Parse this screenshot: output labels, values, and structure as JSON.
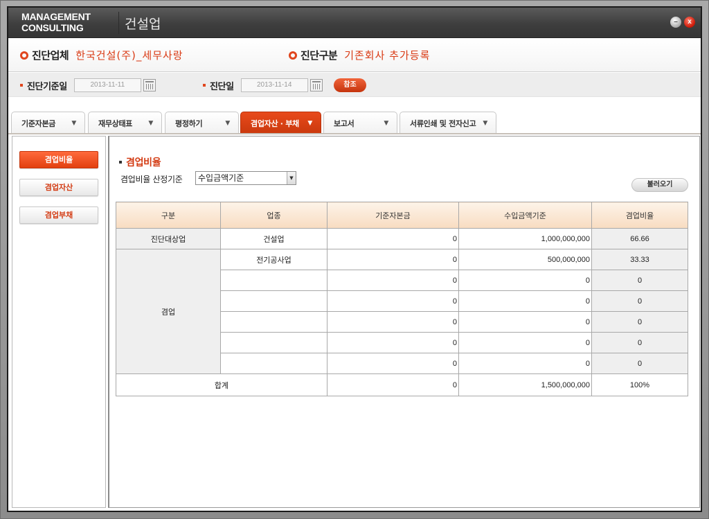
{
  "brand": {
    "line1": "MANAGEMENT",
    "line2": "CONSULTING"
  },
  "app_title": "건설업",
  "window_controls": {
    "minimize": "–",
    "close": "x"
  },
  "info": {
    "company_label": "진단업체",
    "company_value": "한국건설(주)_세무사랑",
    "type_label": "진단구분",
    "type_value": "기존회사 추가등록"
  },
  "dates": {
    "base_date_label": "진단기준일",
    "base_date_value": "2013-11-11",
    "diag_date_label": "진단일",
    "diag_date_value": "2013-11-14",
    "ref_button": "참조"
  },
  "tabs": [
    {
      "label": "기준자본금",
      "active": false
    },
    {
      "label": "재무상태표",
      "active": false
    },
    {
      "label": "평정하기",
      "active": false
    },
    {
      "label": "겸업자산 · 부채",
      "active": true
    },
    {
      "label": "보고서",
      "active": false
    },
    {
      "label": "서류인쇄 및 전자신고",
      "active": false
    }
  ],
  "tab_arrow": "▼",
  "leftnav": [
    {
      "label": "겸업비율",
      "active": true
    },
    {
      "label": "겸업자산",
      "active": false
    },
    {
      "label": "겸업부채",
      "active": false
    }
  ],
  "main": {
    "section_title": "겸업비율",
    "basis_label": "겸업비율 산정기준",
    "basis_selected": "수입금액기준",
    "load_button": "불러오기",
    "table": {
      "headers": [
        "구분",
        "업종",
        "기준자본금",
        "수입금액기준",
        "겸업비율"
      ],
      "target": {
        "category": "진단대상업",
        "industry": "건설업",
        "capital": "0",
        "revenue": "1,000,000,000",
        "ratio": "66.66"
      },
      "side_category": "겸업",
      "side_rows": [
        {
          "industry": "전기공사업",
          "capital": "0",
          "revenue": "500,000,000",
          "ratio": "33.33"
        },
        {
          "industry": "",
          "capital": "0",
          "revenue": "0",
          "ratio": "0"
        },
        {
          "industry": "",
          "capital": "0",
          "revenue": "0",
          "ratio": "0"
        },
        {
          "industry": "",
          "capital": "0",
          "revenue": "0",
          "ratio": "0"
        },
        {
          "industry": "",
          "capital": "0",
          "revenue": "0",
          "ratio": "0"
        },
        {
          "industry": "",
          "capital": "0",
          "revenue": "0",
          "ratio": "0"
        }
      ],
      "total": {
        "label": "합계",
        "capital": "0",
        "revenue": "1,500,000,000",
        "ratio": "100%"
      }
    }
  },
  "colors": {
    "accent": "#e0461e",
    "active_tab": "#d63f12",
    "header_bg": "#f8dcc1"
  }
}
